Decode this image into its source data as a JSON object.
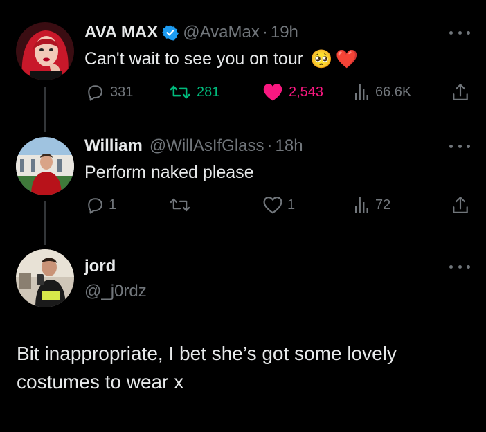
{
  "colors": {
    "background": "#000000",
    "text": "#e7e9ea",
    "muted": "#71767b",
    "verified": "#1d9bf0",
    "retweet_green": "#00ba7c",
    "like_pink": "#f91880"
  },
  "tweet1": {
    "name": "AVA MAX",
    "verified_icon": "verified-badge-icon",
    "handle": "@AvaMax",
    "dot": "·",
    "time": "19h",
    "text": "Can't wait to see you on tour",
    "emoji_1": "🥺",
    "emoji_2": "❤️",
    "replies": "331",
    "retweets": "281",
    "likes": "2,543",
    "views": "66.6K",
    "liked": true,
    "retweeted": true
  },
  "tweet2": {
    "name": "William",
    "handle": "@WillAsIfGlass",
    "dot": "·",
    "time": "18h",
    "text": "Perform naked please",
    "replies": "1",
    "retweets": "",
    "likes": "1",
    "views": "72"
  },
  "tweet3": {
    "name": "jord",
    "handle": "@_j0rdz",
    "text_line_1": "Bit inappropriate, I bet she’s got some lovely",
    "text_line_2": "costumes to wear x"
  }
}
